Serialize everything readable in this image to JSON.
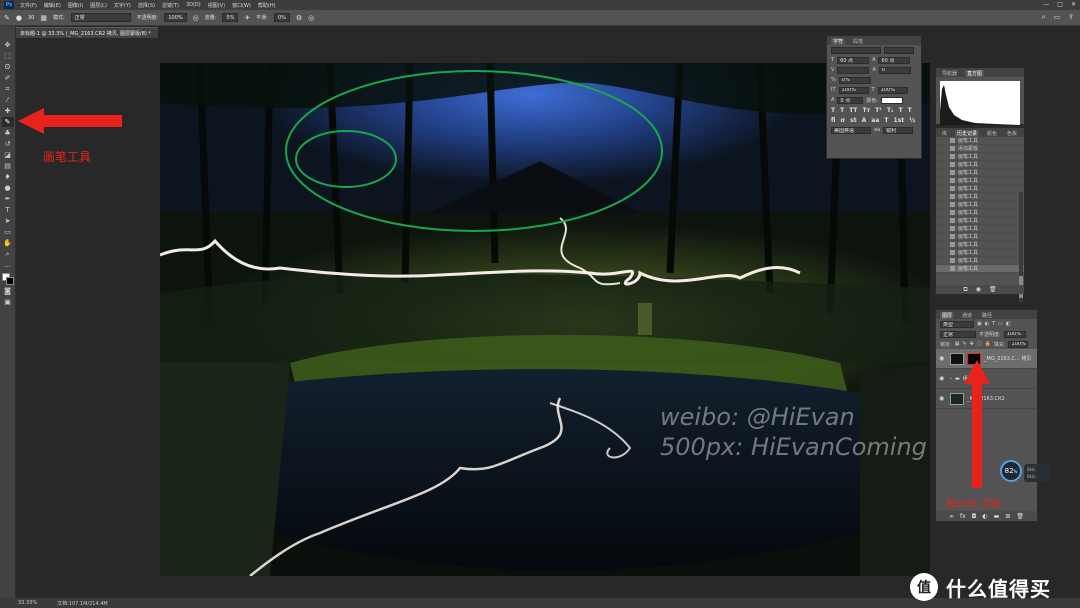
{
  "menubar": {
    "app_icon": "Ps",
    "items": [
      "文件(F)",
      "编辑(E)",
      "图像(I)",
      "图层(L)",
      "文字(Y)",
      "选择(S)",
      "滤镜(T)",
      "3D(D)",
      "视图(V)",
      "窗口(W)",
      "帮助(H)"
    ],
    "window_buttons": [
      "—",
      "□",
      "✕"
    ]
  },
  "options_bar": {
    "brush_size": "30",
    "mode_label": "模式:",
    "mode_value": "正常",
    "opacity_label": "不透明度:",
    "opacity_value": "100%",
    "flow_label": "流量:",
    "flow_value": "5%",
    "smoothing_label": "平滑:",
    "smoothing_value": "0%"
  },
  "document_tab": {
    "title": "未标题-1 @ 33.3% (_MG_2163.CR2 拷贝, 图层蒙版/8) *"
  },
  "toolbar": {
    "tools": [
      "move-tool",
      "marquee-tool",
      "lasso-tool",
      "quick-select-tool",
      "crop-tool",
      "eyedropper-tool",
      "healing-tool",
      "brush-tool",
      "stamp-tool",
      "history-brush-tool",
      "eraser-tool",
      "gradient-tool",
      "blur-tool",
      "dodge-tool",
      "pen-tool",
      "type-tool",
      "path-select-tool",
      "rectangle-tool",
      "hand-tool",
      "zoom-tool",
      "more-tool"
    ],
    "active_tool": "brush-tool"
  },
  "character_panel": {
    "tabs": [
      "字符",
      "段落"
    ],
    "active_tab": "字符",
    "font_size": "60 点",
    "leading": "60 点",
    "tracking": "0",
    "kerning": "0%",
    "vertical_scale": "100%",
    "horizontal_scale": "100%",
    "baseline": "0 点",
    "color_label": "颜色:",
    "language": "美国英语",
    "antialias": "锐利"
  },
  "histogram_panel": {
    "tabs": [
      "导航器",
      "直方图"
    ],
    "active_tab": "直方图"
  },
  "history_panel": {
    "tabs": [
      "库",
      "历史记录",
      "颜色",
      "色板"
    ],
    "active_tab": "历史记录",
    "items": [
      "画笔工具",
      "添加蒙版",
      "画笔工具",
      "画笔工具",
      "画笔工具",
      "画笔工具",
      "画笔工具",
      "画笔工具",
      "画笔工具",
      "画笔工具",
      "画笔工具",
      "画笔工具",
      "画笔工具",
      "画笔工具",
      "画笔工具",
      "画笔工具",
      "画笔工具"
    ]
  },
  "layers_panel": {
    "tabs": [
      "图层",
      "通道",
      "路径"
    ],
    "active_tab": "图层",
    "filter_kind": "类型",
    "blend_mode": "正常",
    "opacity_label": "不透明度:",
    "opacity_value": "100%",
    "lock_label": "锁定:",
    "fill_label": "填充:",
    "fill_value": "100%",
    "layers": [
      {
        "name": "_MG_2163.C... 拷贝",
        "selected": true
      },
      {
        "name": "组 1",
        "selected": false
      },
      {
        "name": "_MG_2163.CR2",
        "selected": false
      }
    ]
  },
  "dial": {
    "value": "82",
    "suffix": "%",
    "rate_up": "0k/s",
    "rate_down": "0k/s"
  },
  "statusbar": {
    "zoom": "33.33%",
    "doc_info": "文档:107.1M/214.4M"
  },
  "annotations": {
    "brush_tool_label": "画笔工具",
    "shift_click_label": "按shift 点选",
    "arrow_color": "#e8231c",
    "ellipse_color": "#1aa64a"
  },
  "photo_watermark": {
    "line1": "weibo: @HiEvan",
    "line2": "500px: HiEvanComing"
  },
  "site_watermark": {
    "icon": "值",
    "text": "什么值得买"
  }
}
